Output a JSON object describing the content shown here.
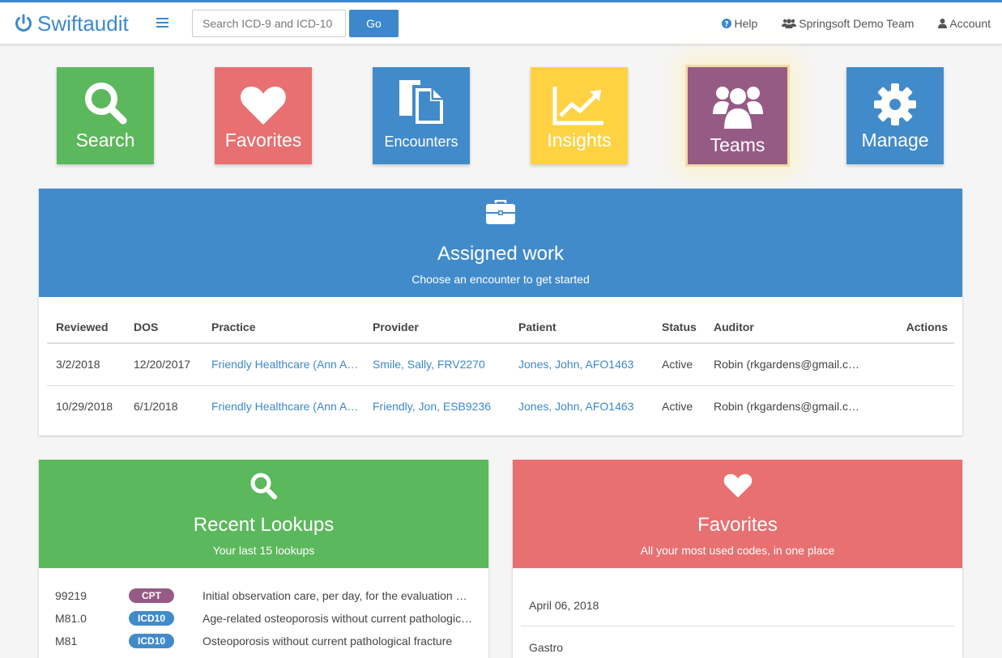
{
  "app": {
    "name": "Swiftaudit"
  },
  "search": {
    "placeholder": "Search ICD-9 and ICD-10",
    "go_label": "Go"
  },
  "nav": {
    "help": "Help",
    "team": "Springsoft Demo Team",
    "account": "Account"
  },
  "tiles": [
    {
      "label": "Search",
      "color": "#5cb85c",
      "icon": "search-icon"
    },
    {
      "label": "Favorites",
      "color": "#e87070",
      "icon": "heart-icon"
    },
    {
      "label": "Encounters",
      "color": "#428bca",
      "icon": "documents-icon"
    },
    {
      "label": "Insights",
      "color": "#fed243",
      "icon": "chart-icon"
    },
    {
      "label": "Teams",
      "color": "#965b85",
      "icon": "users-icon",
      "active": true
    },
    {
      "label": "Manage",
      "color": "#428bca",
      "icon": "gear-icon"
    }
  ],
  "assigned": {
    "title": "Assigned work",
    "subtitle": "Choose an encounter to get started",
    "color": "#428bca",
    "columns": [
      "Reviewed",
      "DOS",
      "Practice",
      "Provider",
      "Patient",
      "Status",
      "Auditor",
      "Actions"
    ],
    "rows": [
      {
        "reviewed": "3/2/2018",
        "dos": "12/20/2017",
        "practice": "Friendly Healthcare (Ann A…",
        "provider": "Smile, Sally, FRV2270",
        "patient": "Jones, John, AFO1463",
        "status": "Active",
        "auditor": "Robin (rkgardens@gmail.c…"
      },
      {
        "reviewed": "10/29/2018",
        "dos": "6/1/2018",
        "practice": "Friendly Healthcare (Ann A…",
        "provider": "Friendly, Jon, ESB9236",
        "patient": "Jones, John, AFO1463",
        "status": "Active",
        "auditor": "Robin (rkgardens@gmail.c…"
      }
    ]
  },
  "lookups": {
    "title": "Recent Lookups",
    "subtitle": "Your last 15 lookups",
    "color": "#5cb85c",
    "items": [
      {
        "code": "99219",
        "type": "CPT",
        "type_color": "#965b85",
        "desc": "Initial observation care, per day, for the evaluation …"
      },
      {
        "code": "M81.0",
        "type": "ICD10",
        "type_color": "#428bca",
        "desc": "Age-related osteoporosis without current pathologic…"
      },
      {
        "code": "M81",
        "type": "ICD10",
        "type_color": "#428bca",
        "desc": "Osteoporosis without current pathological fracture"
      }
    ]
  },
  "favorites": {
    "title": "Favorites",
    "subtitle": "All your most used codes, in one place",
    "color": "#e87070",
    "items": [
      "April 06, 2018",
      "Gastro"
    ]
  }
}
